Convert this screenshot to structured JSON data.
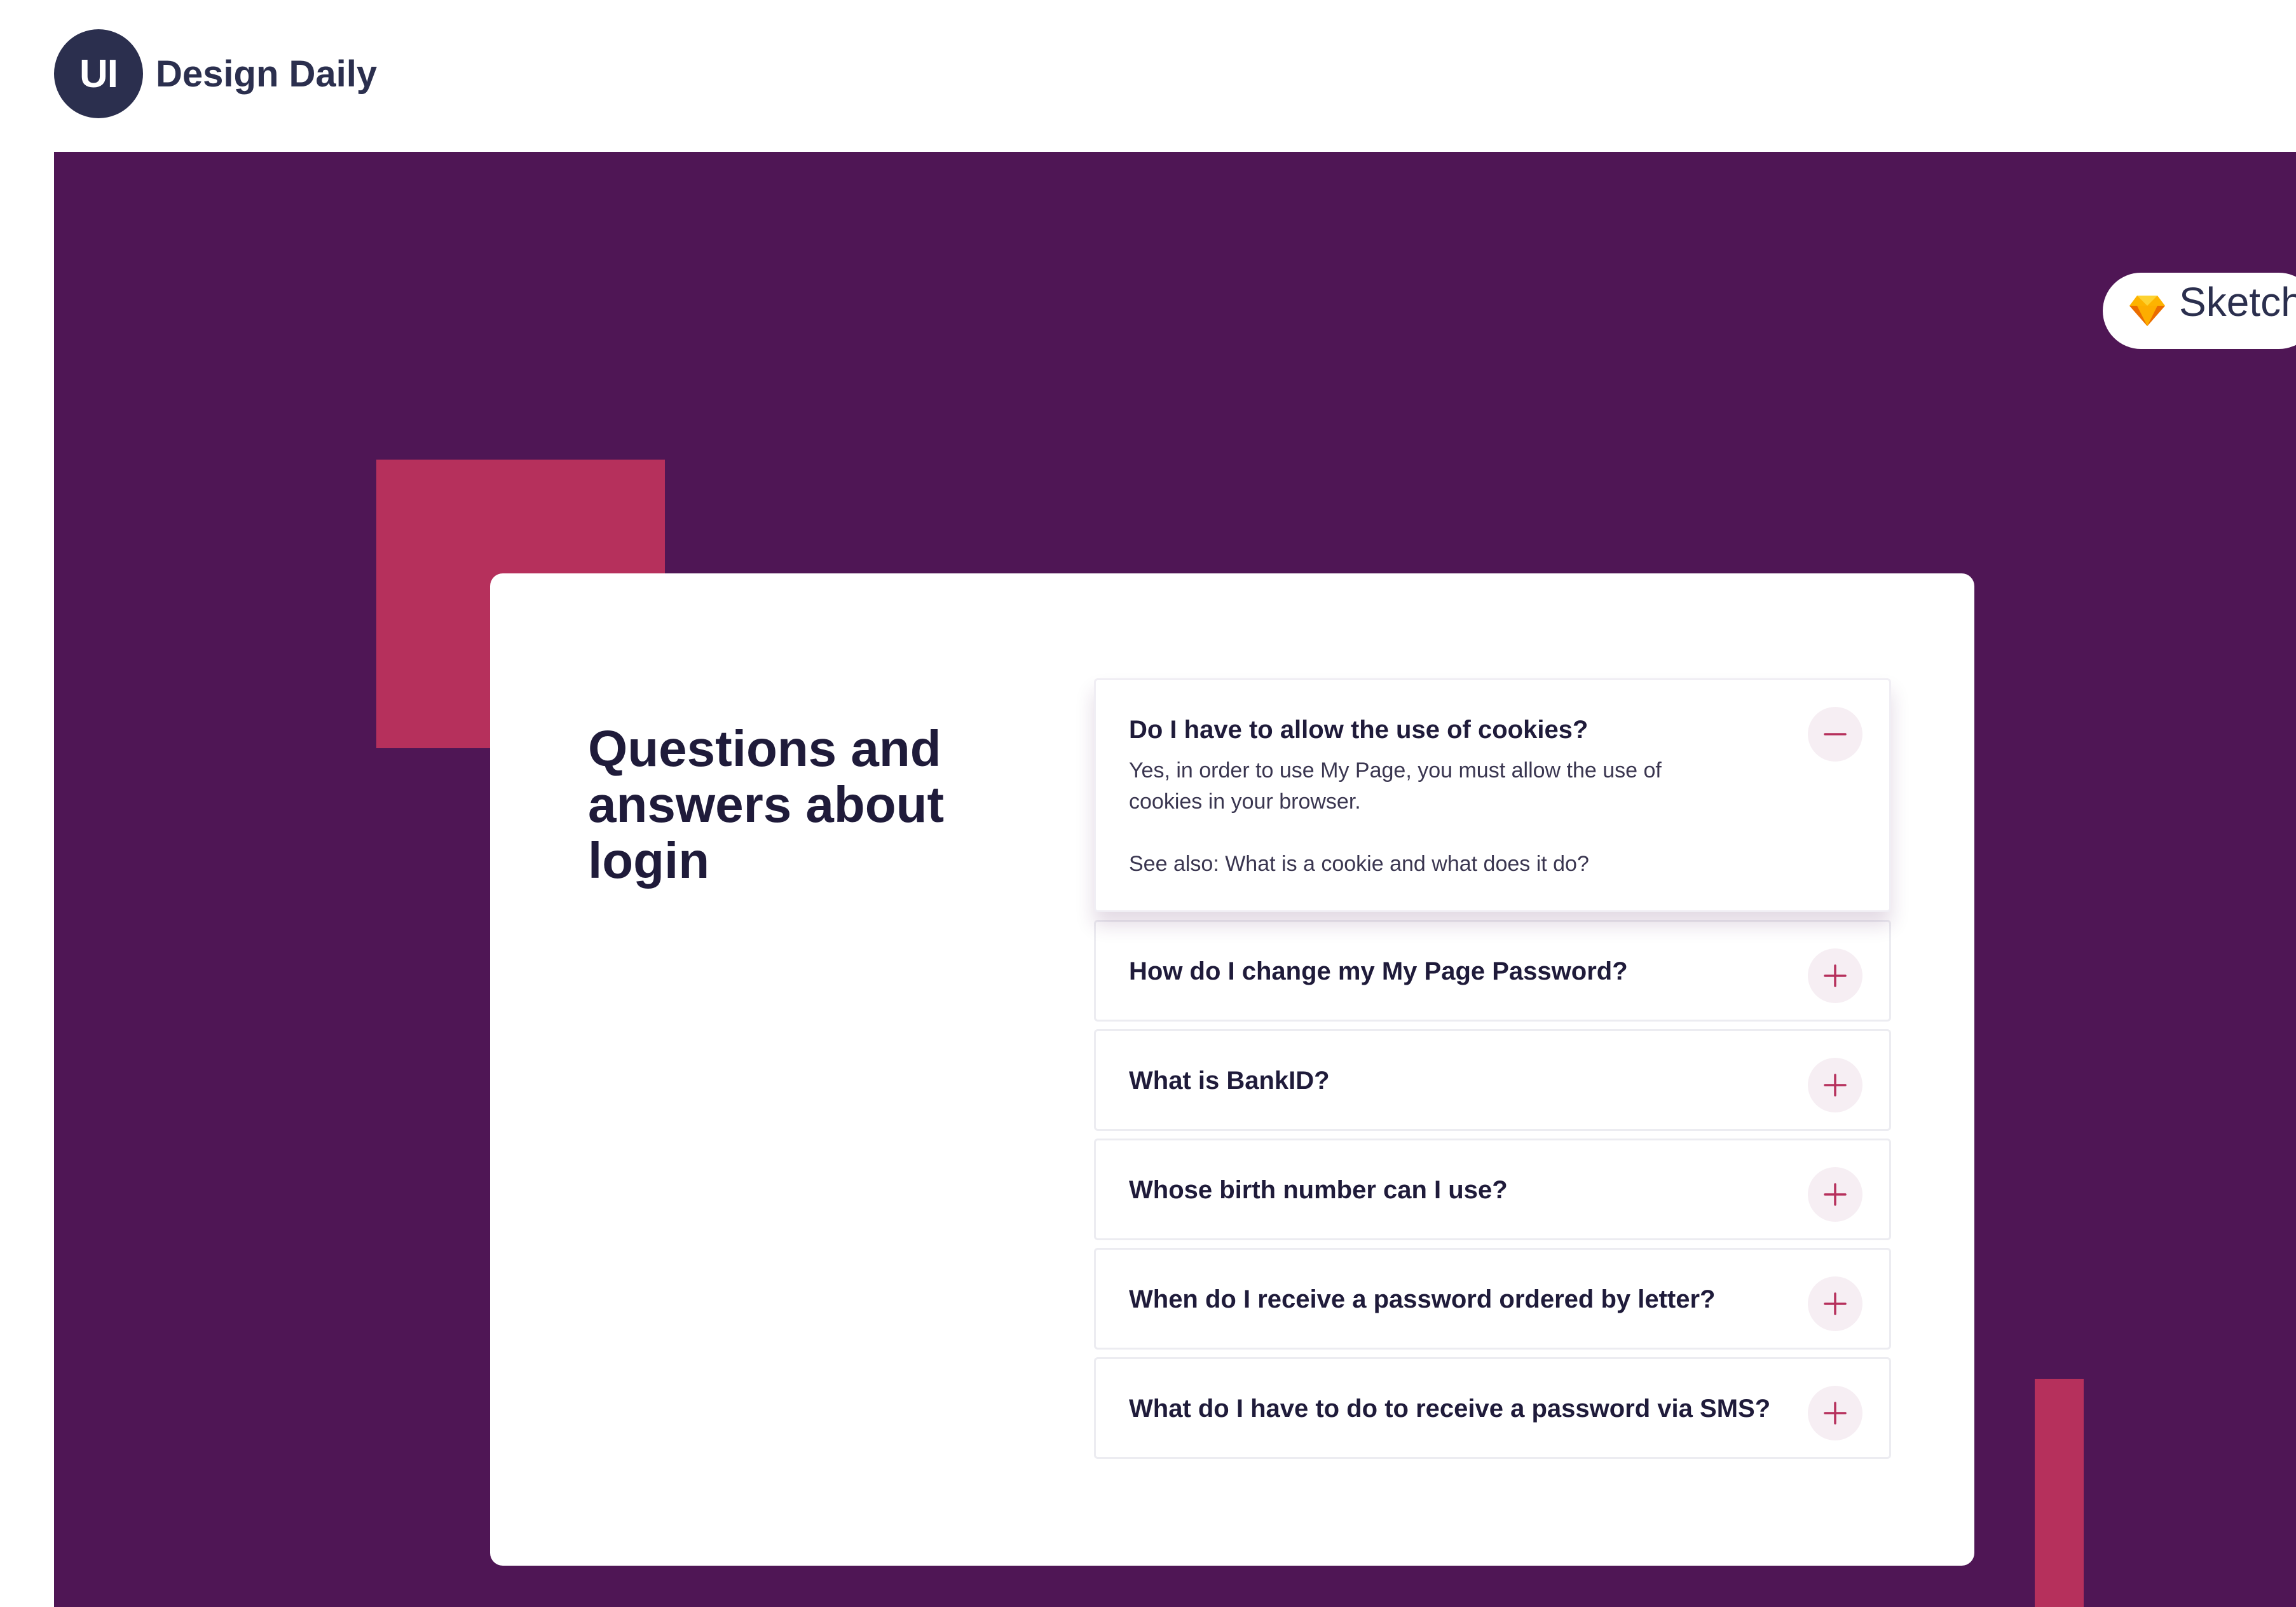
{
  "brand": {
    "badge": "UI",
    "name": "Design Daily"
  },
  "tool": {
    "label": "Sketch",
    "icon": "sketch-diamond-icon"
  },
  "card": {
    "title": "Questions and answers about login"
  },
  "faq": [
    {
      "question": "Do I have to allow the use of cookies?",
      "expanded": true,
      "answer": "Yes, in order to use My Page, you must allow the use of cookies in your browser.",
      "see_also": "See also: What is a cookie and what does it do?",
      "toggle_icon": "minus-icon"
    },
    {
      "question": "How do I change my My Page Password?",
      "expanded": false,
      "toggle_icon": "plus-icon"
    },
    {
      "question": "What is BankID?",
      "expanded": false,
      "toggle_icon": "plus-icon"
    },
    {
      "question": "Whose birth number can I use?",
      "expanded": false,
      "toggle_icon": "plus-icon"
    },
    {
      "question": "When do I receive a password ordered by letter?",
      "expanded": false,
      "toggle_icon": "plus-icon"
    },
    {
      "question": "What do I have to do to receive a password via SMS?",
      "expanded": false,
      "toggle_icon": "plus-icon"
    }
  ],
  "colors": {
    "background_purple": "#4f1655",
    "accent_crimson": "#b6305c",
    "brand_navy": "#2b2f4e",
    "toggle_bg": "#f6eef3"
  }
}
